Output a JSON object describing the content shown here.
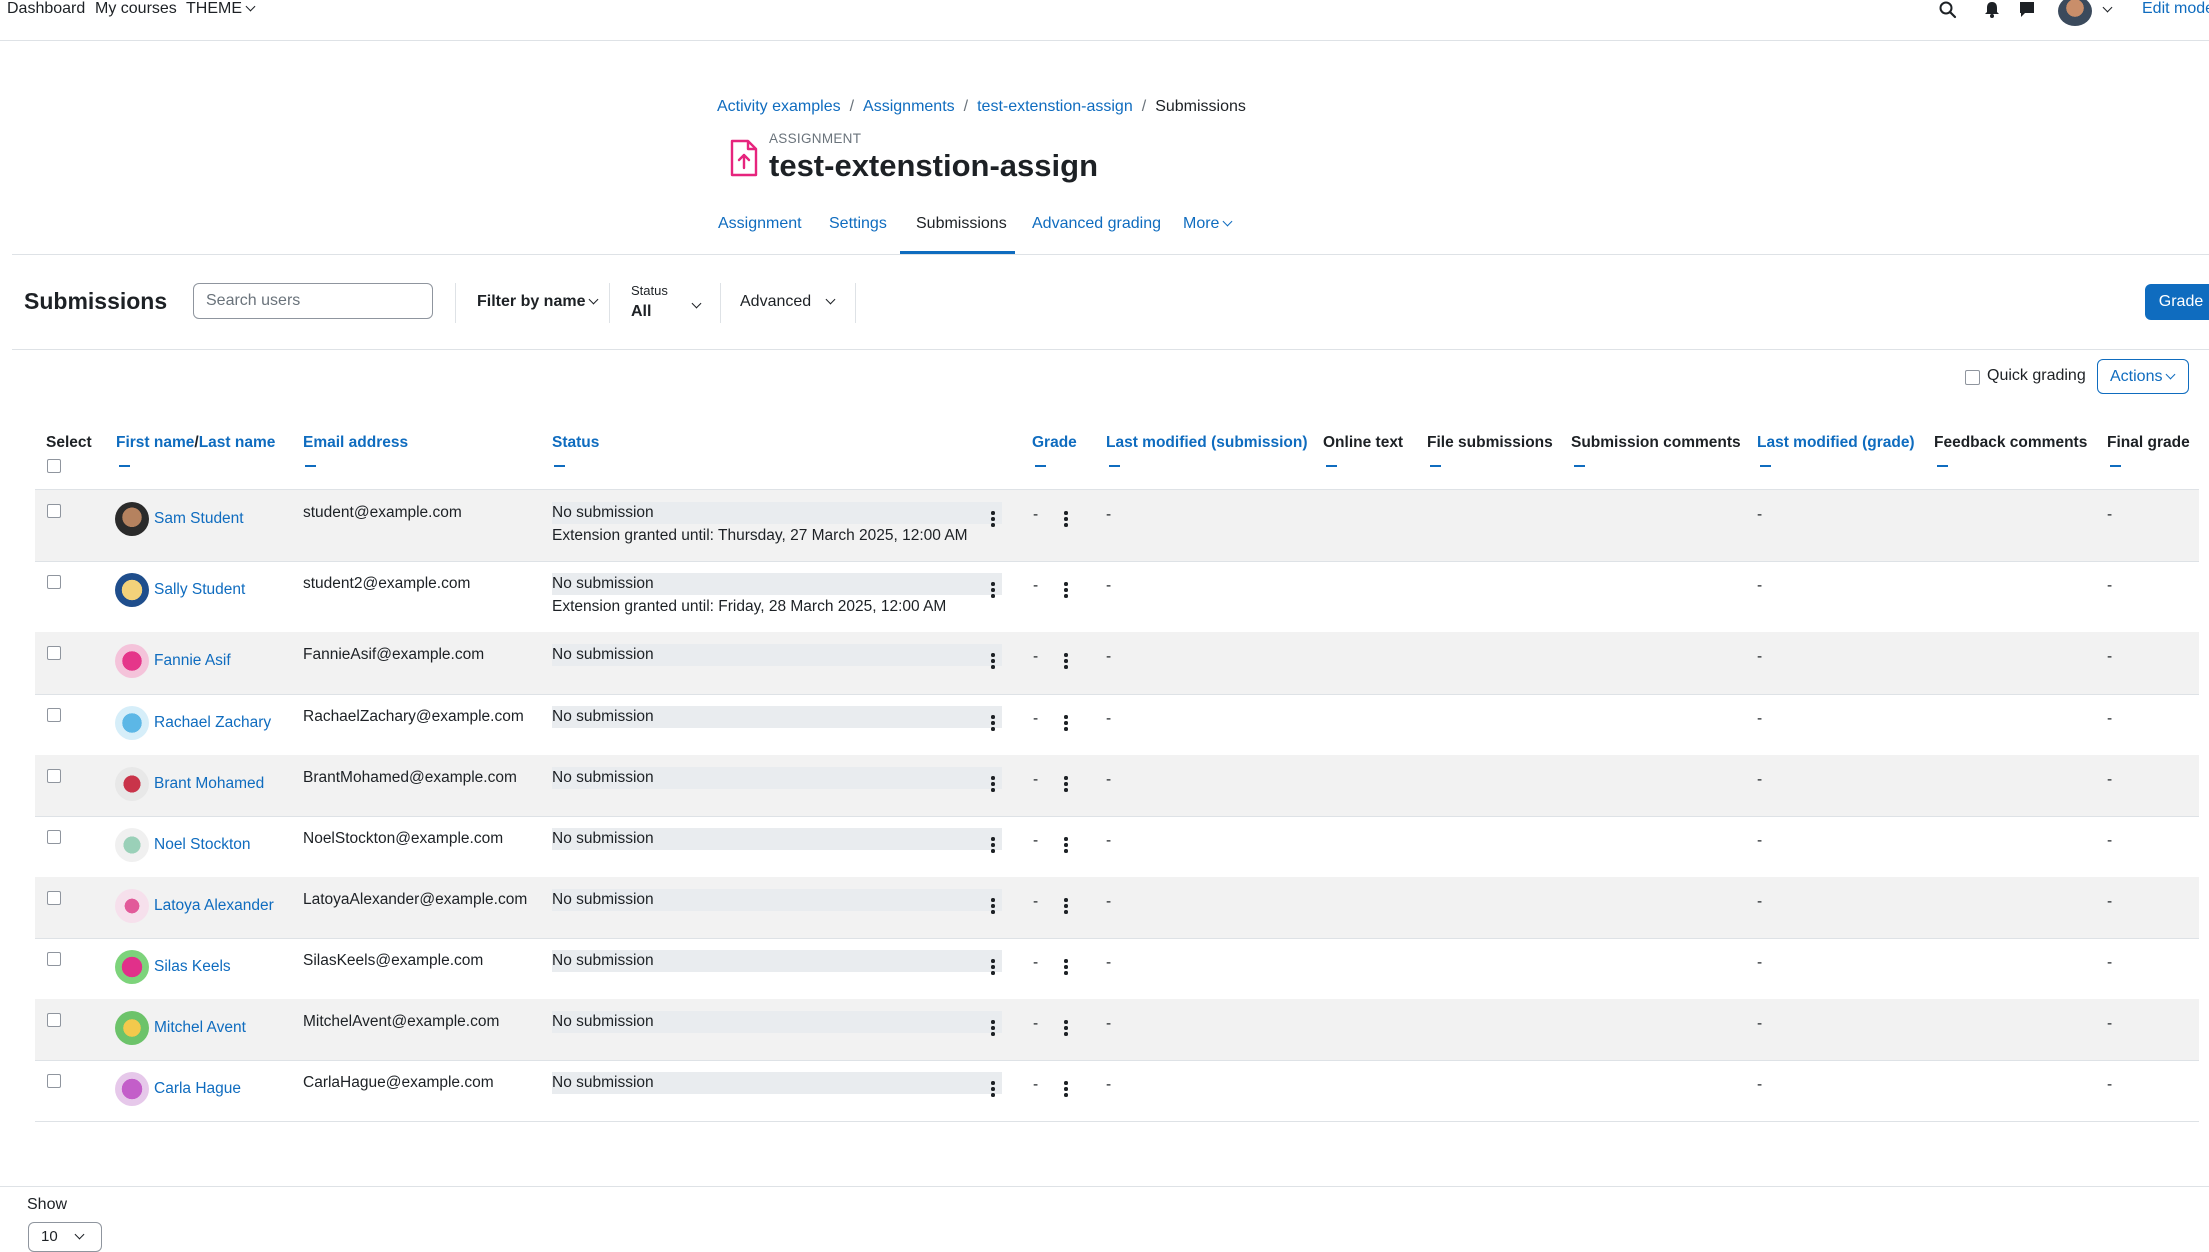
{
  "navbar": {
    "items": [
      "Dashboard",
      "My courses",
      "THEME"
    ],
    "edit_mode": "Edit mode",
    "icons": [
      "search-icon",
      "bell-icon",
      "chat-icon",
      "user-avatar",
      "chevron-down-icon"
    ]
  },
  "breadcrumb": [
    "Activity examples",
    "Assignments",
    "test-extenstion-assign",
    "Submissions"
  ],
  "header": {
    "kicker": "ASSIGNMENT",
    "title": "test-extenstion-assign"
  },
  "tabs": [
    "Assignment",
    "Settings",
    "Submissions",
    "Advanced grading",
    "More"
  ],
  "active_tab": "Submissions",
  "toolbar": {
    "title": "Submissions",
    "search_placeholder": "Search users",
    "filter_by_name": "Filter by name",
    "status_label": "Status",
    "status_value": "All",
    "advanced": "Advanced",
    "grade_button": "Grade"
  },
  "options": {
    "quick_grading": "Quick grading",
    "actions": "Actions"
  },
  "table": {
    "headers": {
      "select": "Select",
      "first_name": "First name",
      "slash": "/",
      "last_name": "Last name",
      "email": "Email address",
      "status": "Status",
      "grade": "Grade",
      "last_modified_submission": "Last modified (submission)",
      "online_text": "Online text",
      "file_submissions": "File submissions",
      "submission_comments": "Submission comments",
      "last_modified_grade": "Last modified (grade)",
      "feedback_comments": "Feedback comments",
      "final_grade": "Final grade"
    },
    "rows": [
      {
        "name": "Sam Student",
        "email": "student@example.com",
        "status": "No submission",
        "extension": "Extension granted until: Thursday, 27 March 2025, 12:00 AM",
        "grade": "-",
        "last_modified_submission": "-",
        "last_modified_grade": "-",
        "final_grade": "-"
      },
      {
        "name": "Sally Student",
        "email": "student2@example.com",
        "status": "No submission",
        "extension": "Extension granted until: Friday, 28 March 2025, 12:00 AM",
        "grade": "-",
        "last_modified_submission": "-",
        "last_modified_grade": "-",
        "final_grade": "-"
      },
      {
        "name": "Fannie Asif",
        "email": "FannieAsif@example.com",
        "status": "No submission",
        "extension": "",
        "grade": "-",
        "last_modified_submission": "-",
        "last_modified_grade": "-",
        "final_grade": "-"
      },
      {
        "name": "Rachael Zachary",
        "email": "RachaelZachary@example.com",
        "status": "No submission",
        "extension": "",
        "grade": "-",
        "last_modified_submission": "-",
        "last_modified_grade": "-",
        "final_grade": "-"
      },
      {
        "name": "Brant Mohamed",
        "email": "BrantMohamed@example.com",
        "status": "No submission",
        "extension": "",
        "grade": "-",
        "last_modified_submission": "-",
        "last_modified_grade": "-",
        "final_grade": "-"
      },
      {
        "name": "Noel Stockton",
        "email": "NoelStockton@example.com",
        "status": "No submission",
        "extension": "",
        "grade": "-",
        "last_modified_submission": "-",
        "last_modified_grade": "-",
        "final_grade": "-"
      },
      {
        "name": "Latoya Alexander",
        "email": "LatoyaAlexander@example.com",
        "status": "No submission",
        "extension": "",
        "grade": "-",
        "last_modified_submission": "-",
        "last_modified_grade": "-",
        "final_grade": "-"
      },
      {
        "name": "Silas Keels",
        "email": "SilasKeels@example.com",
        "status": "No submission",
        "extension": "",
        "grade": "-",
        "last_modified_submission": "-",
        "last_modified_grade": "-",
        "final_grade": "-"
      },
      {
        "name": "Mitchel Avent",
        "email": "MitchelAvent@example.com",
        "status": "No submission",
        "extension": "",
        "grade": "-",
        "last_modified_submission": "-",
        "last_modified_grade": "-",
        "final_grade": "-"
      },
      {
        "name": "Carla Hague",
        "email": "CarlaHague@example.com",
        "status": "No submission",
        "extension": "",
        "grade": "-",
        "last_modified_submission": "-",
        "last_modified_grade": "-",
        "final_grade": "-"
      }
    ]
  },
  "footer": {
    "show_label": "Show",
    "per_page": "10"
  },
  "colors": {
    "link": "#0f6cbf",
    "text": "#1d2125",
    "row_stripe": "#f2f2f2",
    "assignment_icon": "#e6247d"
  }
}
